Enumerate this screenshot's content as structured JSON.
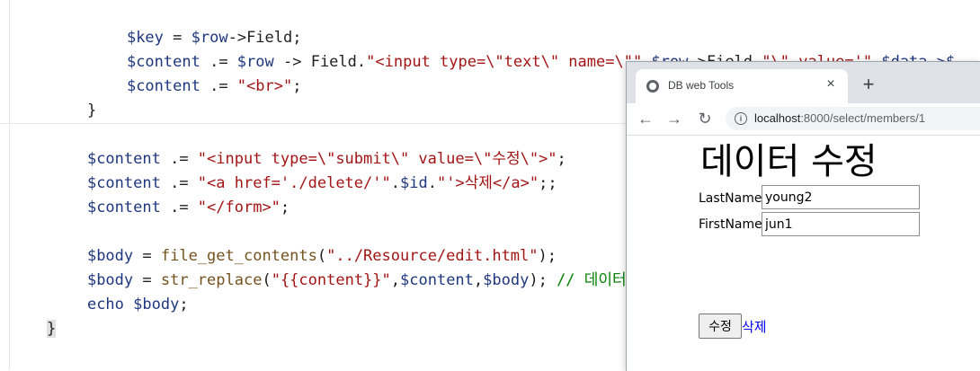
{
  "editor": {
    "lines": {
      "l1": [
        "$key",
        " = ",
        "$row",
        "->",
        "Field",
        ";"
      ],
      "l2a": [
        "$content",
        " .= ",
        "$row",
        " -> ",
        "Field",
        "."
      ],
      "l2b": "\"<input type=\\\"text\\\" name=\\\"\"",
      "l2c": ".",
      "l2d": "$row",
      "l2e": "->Field.",
      "l2f": "\"\\\" value='\"",
      "l2g": ".$data->$",
      "l3a": "$content",
      "l3b": " .= ",
      "l3c": "\"<br>\"",
      "l3d": ";",
      "l4": "}",
      "l5a": "$content",
      "l5b": " .= ",
      "l5c": "\"<input type=\\\"submit\\\" value=\\\"수정\\\">\"",
      "l5d": ";",
      "l6a": "$content",
      "l6b": " .= ",
      "l6c": "\"<a href='./delete/'\"",
      "l6d": ".",
      "l6e": "$id",
      "l6f": ".",
      "l6g": "\"'>삭제</a>\"",
      "l6h": ";;",
      "l7a": "$content",
      "l7b": " .= ",
      "l7c": "\"</form>\"",
      "l7d": ";",
      "l8a": "$body",
      "l8b": " = ",
      "l8c": "file_get_contents",
      "l8d": "(",
      "l8e": "\"../Resource/edit.html\"",
      "l8f": ");",
      "l9a": "$body",
      "l9b": " = ",
      "l9c": "str_replace",
      "l9d": "(",
      "l9e": "\"{{content}}\"",
      "l9f": ",",
      "l9g": "$content",
      "l9h": ",",
      "l9i": "$body",
      "l9j": "); ",
      "l9k": "// 데이터",
      "l10a": "echo",
      "l10b": " ",
      "l10c": "$body",
      "l10d": ";",
      "l11": "}"
    }
  },
  "browser": {
    "tab_title": "DB web Tools",
    "tab_close": "×",
    "new_tab": "+",
    "back": "←",
    "forward": "→",
    "reload": "↻",
    "info": "i",
    "url_host": "localhost",
    "url_rest": ":8000/select/members/1",
    "page": {
      "heading": "데이터 수정",
      "fields": [
        {
          "label": "LastName",
          "value": "young2"
        },
        {
          "label": "FirstName",
          "value": "jun1"
        }
      ],
      "submit_label": "수정",
      "delete_link": "삭제"
    }
  },
  "colors": {
    "variable": "#1f377f",
    "string": "#a31515",
    "function": "#74531f",
    "comment": "#008000",
    "link": "#0000ee"
  }
}
